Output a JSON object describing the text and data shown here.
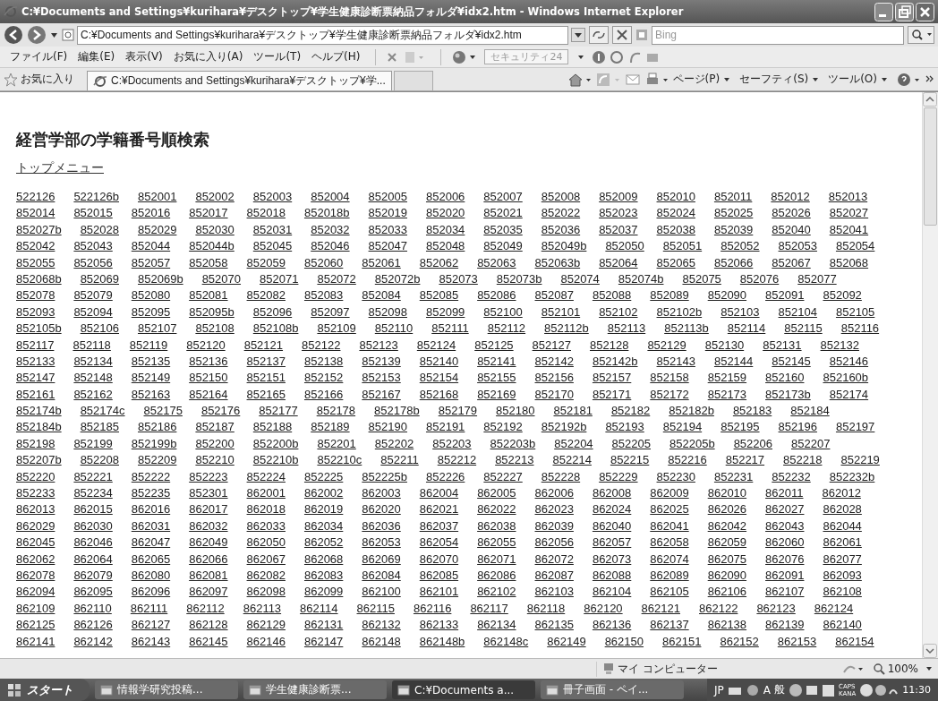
{
  "window": {
    "title": "C:¥Documents and Settings¥kurihara¥デスクトップ¥学生健康診断票納品フォルダ¥idx2.htm - Windows Internet Explorer"
  },
  "address_bar": {
    "value": "C:¥Documents and Settings¥kurihara¥デスクトップ¥学生健康診断票納品フォルダ¥idx2.htm"
  },
  "search": {
    "placeholder": "Bing"
  },
  "menu": [
    "ファイル(F)",
    "編集(E)",
    "表示(V)",
    "お気に入り(A)",
    "ツール(T)",
    "ヘルプ(H)"
  ],
  "toolbar": {
    "security_field": "セキュリティ24"
  },
  "favorites_bar": {
    "label": "お気に入り",
    "tab": "C:¥Documents and Settings¥kurihara¥デスクトップ¥学..."
  },
  "command_bar": [
    "ページ(P)",
    "セーフティ(S)",
    "ツール(O)"
  ],
  "page": {
    "heading": "経営学部の学籍番号順検索",
    "top_link": "トップメニュー",
    "link_rows": [
      [
        "522126",
        "522126b",
        "852001",
        "852002",
        "852003",
        "852004",
        "852005",
        "852006",
        "852007",
        "852008",
        "852009",
        "852010",
        "852011",
        "852012",
        "852013"
      ],
      [
        "852014",
        "852015",
        "852016",
        "852017",
        "852018",
        "852018b",
        "852019",
        "852020",
        "852021",
        "852022",
        "852023",
        "852024",
        "852025",
        "852026",
        "852027"
      ],
      [
        "852027b",
        "852028",
        "852029",
        "852030",
        "852031",
        "852032",
        "852033",
        "852034",
        "852035",
        "852036",
        "852037",
        "852038",
        "852039",
        "852040",
        "852041"
      ],
      [
        "852042",
        "852043",
        "852044",
        "852044b",
        "852045",
        "852046",
        "852047",
        "852048",
        "852049",
        "852049b",
        "852050",
        "852051",
        "852052",
        "852053",
        "852054"
      ],
      [
        "852055",
        "852056",
        "852057",
        "852058",
        "852059",
        "852060",
        "852061",
        "852062",
        "852063",
        "852063b",
        "852064",
        "852065",
        "852066",
        "852067",
        "852068"
      ],
      [
        "852068b",
        "852069",
        "852069b",
        "852070",
        "852071",
        "852072",
        "852072b",
        "852073",
        "852073b",
        "852074",
        "852074b",
        "852075",
        "852076",
        "852077"
      ],
      [
        "852078",
        "852079",
        "852080",
        "852081",
        "852082",
        "852083",
        "852084",
        "852085",
        "852086",
        "852087",
        "852088",
        "852089",
        "852090",
        "852091",
        "852092"
      ],
      [
        "852093",
        "852094",
        "852095",
        "852095b",
        "852096",
        "852097",
        "852098",
        "852099",
        "852100",
        "852101",
        "852102",
        "852102b",
        "852103",
        "852104",
        "852105"
      ],
      [
        "852105b",
        "852106",
        "852107",
        "852108",
        "852108b",
        "852109",
        "852110",
        "852111",
        "852112",
        "852112b",
        "852113",
        "852113b",
        "852114",
        "852115",
        "852116"
      ],
      [
        "852117",
        "852118",
        "852119",
        "852120",
        "852121",
        "852122",
        "852123",
        "852124",
        "852125",
        "852127",
        "852128",
        "852129",
        "852130",
        "852131",
        "852132"
      ],
      [
        "852133",
        "852134",
        "852135",
        "852136",
        "852137",
        "852138",
        "852139",
        "852140",
        "852141",
        "852142",
        "852142b",
        "852143",
        "852144",
        "852145",
        "852146"
      ],
      [
        "852147",
        "852148",
        "852149",
        "852150",
        "852151",
        "852152",
        "852153",
        "852154",
        "852155",
        "852156",
        "852157",
        "852158",
        "852159",
        "852160",
        "852160b"
      ],
      [
        "852161",
        "852162",
        "852163",
        "852164",
        "852165",
        "852166",
        "852167",
        "852168",
        "852169",
        "852170",
        "852171",
        "852172",
        "852173",
        "852173b",
        "852174"
      ],
      [
        "852174b",
        "852174c",
        "852175",
        "852176",
        "852177",
        "852178",
        "852178b",
        "852179",
        "852180",
        "852181",
        "852182",
        "852182b",
        "852183",
        "852184"
      ],
      [
        "852184b",
        "852185",
        "852186",
        "852187",
        "852188",
        "852189",
        "852190",
        "852191",
        "852192",
        "852192b",
        "852193",
        "852194",
        "852195",
        "852196",
        "852197"
      ],
      [
        "852198",
        "852199",
        "852199b",
        "852200",
        "852200b",
        "852201",
        "852202",
        "852203",
        "852203b",
        "852204",
        "852205",
        "852205b",
        "852206",
        "852207"
      ],
      [
        "852207b",
        "852208",
        "852209",
        "852210",
        "852210b",
        "852210c",
        "852211",
        "852212",
        "852213",
        "852214",
        "852215",
        "852216",
        "852217",
        "852218",
        "852219"
      ],
      [
        "852220",
        "852221",
        "852222",
        "852223",
        "852224",
        "852225",
        "852225b",
        "852226",
        "852227",
        "852228",
        "852229",
        "852230",
        "852231",
        "852232",
        "852232b"
      ],
      [
        "852233",
        "852234",
        "852235",
        "852301",
        "862001",
        "862002",
        "862003",
        "862004",
        "862005",
        "862006",
        "862008",
        "862009",
        "862010",
        "862011",
        "862012"
      ],
      [
        "862013",
        "862015",
        "862016",
        "862017",
        "862018",
        "862019",
        "862020",
        "862021",
        "862022",
        "862023",
        "862024",
        "862025",
        "862026",
        "862027",
        "862028"
      ],
      [
        "862029",
        "862030",
        "862031",
        "862032",
        "862033",
        "862034",
        "862036",
        "862037",
        "862038",
        "862039",
        "862040",
        "862041",
        "862042",
        "862043",
        "862044"
      ],
      [
        "862045",
        "862046",
        "862047",
        "862049",
        "862050",
        "862052",
        "862053",
        "862054",
        "862055",
        "862056",
        "862057",
        "862058",
        "862059",
        "862060",
        "862061"
      ],
      [
        "862062",
        "862064",
        "862065",
        "862066",
        "862067",
        "862068",
        "862069",
        "862070",
        "862071",
        "862072",
        "862073",
        "862074",
        "862075",
        "862076",
        "862077"
      ],
      [
        "862078",
        "862079",
        "862080",
        "862081",
        "862082",
        "862083",
        "862084",
        "862085",
        "862086",
        "862087",
        "862088",
        "862089",
        "862090",
        "862091",
        "862093"
      ],
      [
        "862094",
        "862095",
        "862096",
        "862097",
        "862098",
        "862099",
        "862100",
        "862101",
        "862102",
        "862103",
        "862104",
        "862105",
        "862106",
        "862107",
        "862108"
      ],
      [
        "862109",
        "862110",
        "862111",
        "862112",
        "862113",
        "862114",
        "862115",
        "862116",
        "862117",
        "862118",
        "862120",
        "862121",
        "862122",
        "862123",
        "862124"
      ],
      [
        "862125",
        "862126",
        "862127",
        "862128",
        "862129",
        "862131",
        "862132",
        "862133",
        "862134",
        "862135",
        "862136",
        "862137",
        "862138",
        "862139",
        "862140"
      ],
      [
        "862141",
        "862142",
        "862143",
        "862145",
        "862146",
        "862147",
        "862148",
        "862148b",
        "862148c",
        "862149",
        "862150",
        "862151",
        "862152",
        "862153",
        "862154"
      ]
    ]
  },
  "status_bar": {
    "zone": "マイ コンピューター",
    "zoom": "100%"
  },
  "taskbar": {
    "start": "スタート",
    "tasks": [
      {
        "label": "情報学研究投稿...",
        "selected": false
      },
      {
        "label": "学生健康診断票...",
        "selected": false
      },
      {
        "label": "C:¥Documents a...",
        "selected": true
      },
      {
        "label": "冊子画面 - ペイ...",
        "selected": false
      }
    ],
    "ime": [
      "JP",
      "A",
      "般"
    ],
    "caps": "CAPS",
    "kana": "KANA",
    "clock": "11:30"
  }
}
